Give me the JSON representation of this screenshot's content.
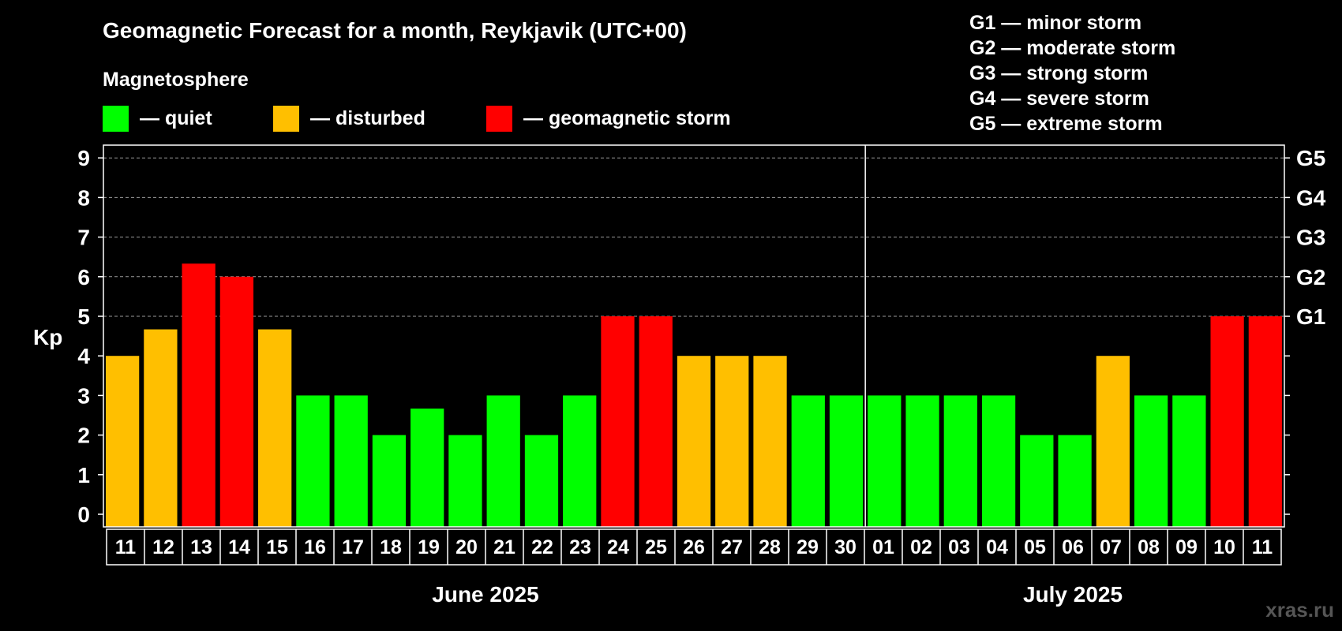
{
  "chart_data": {
    "type": "bar",
    "title": "Geomagnetic Forecast for a month, Reykjavik (UTC+00)",
    "legend_title": "Magnetosphere",
    "legend": [
      {
        "label": "— quiet",
        "color": "#00ff00"
      },
      {
        "label": "— disturbed",
        "color": "#ffbf00"
      },
      {
        "label": "— geomagnetic storm",
        "color": "#ff0000"
      }
    ],
    "storm_scale": [
      "G1 — minor storm",
      "G2 — moderate storm",
      "G3 — strong storm",
      "G4 — severe storm",
      "G5 — extreme storm"
    ],
    "ylabel": "Kp",
    "ylim": [
      0,
      9
    ],
    "yticks": [
      "0",
      "1",
      "2",
      "3",
      "4",
      "5",
      "6",
      "7",
      "8",
      "9"
    ],
    "right_ticks": [
      {
        "value": 5,
        "label": "G1"
      },
      {
        "value": 6,
        "label": "G2"
      },
      {
        "value": 7,
        "label": "G3"
      },
      {
        "value": 8,
        "label": "G4"
      },
      {
        "value": 9,
        "label": "G5"
      }
    ],
    "grid": "dashed horizontal at Kp 5-9",
    "months": [
      {
        "label": "June 2025",
        "days": 20
      },
      {
        "label": "July 2025",
        "days": 11
      }
    ],
    "categories": [
      "11",
      "12",
      "13",
      "14",
      "15",
      "16",
      "17",
      "18",
      "19",
      "20",
      "21",
      "22",
      "23",
      "24",
      "25",
      "26",
      "27",
      "28",
      "29",
      "30",
      "01",
      "02",
      "03",
      "04",
      "05",
      "06",
      "07",
      "08",
      "09",
      "10",
      "11"
    ],
    "values": [
      4,
      4.67,
      6.33,
      6,
      4.67,
      3,
      3,
      2,
      2.67,
      2,
      3,
      2,
      3,
      5,
      5,
      4,
      4,
      4,
      3,
      3,
      3,
      3,
      3,
      3,
      2,
      2,
      4,
      3,
      3,
      5,
      5
    ],
    "status": [
      "disturbed",
      "disturbed",
      "storm",
      "storm",
      "disturbed",
      "quiet",
      "quiet",
      "quiet",
      "quiet",
      "quiet",
      "quiet",
      "quiet",
      "quiet",
      "storm",
      "storm",
      "disturbed",
      "disturbed",
      "disturbed",
      "quiet",
      "quiet",
      "quiet",
      "quiet",
      "quiet",
      "quiet",
      "quiet",
      "quiet",
      "disturbed",
      "quiet",
      "quiet",
      "storm",
      "storm"
    ],
    "colors": {
      "quiet": "#00ff00",
      "disturbed": "#ffbf00",
      "storm": "#ff0000"
    }
  },
  "watermark": "xras.ru"
}
